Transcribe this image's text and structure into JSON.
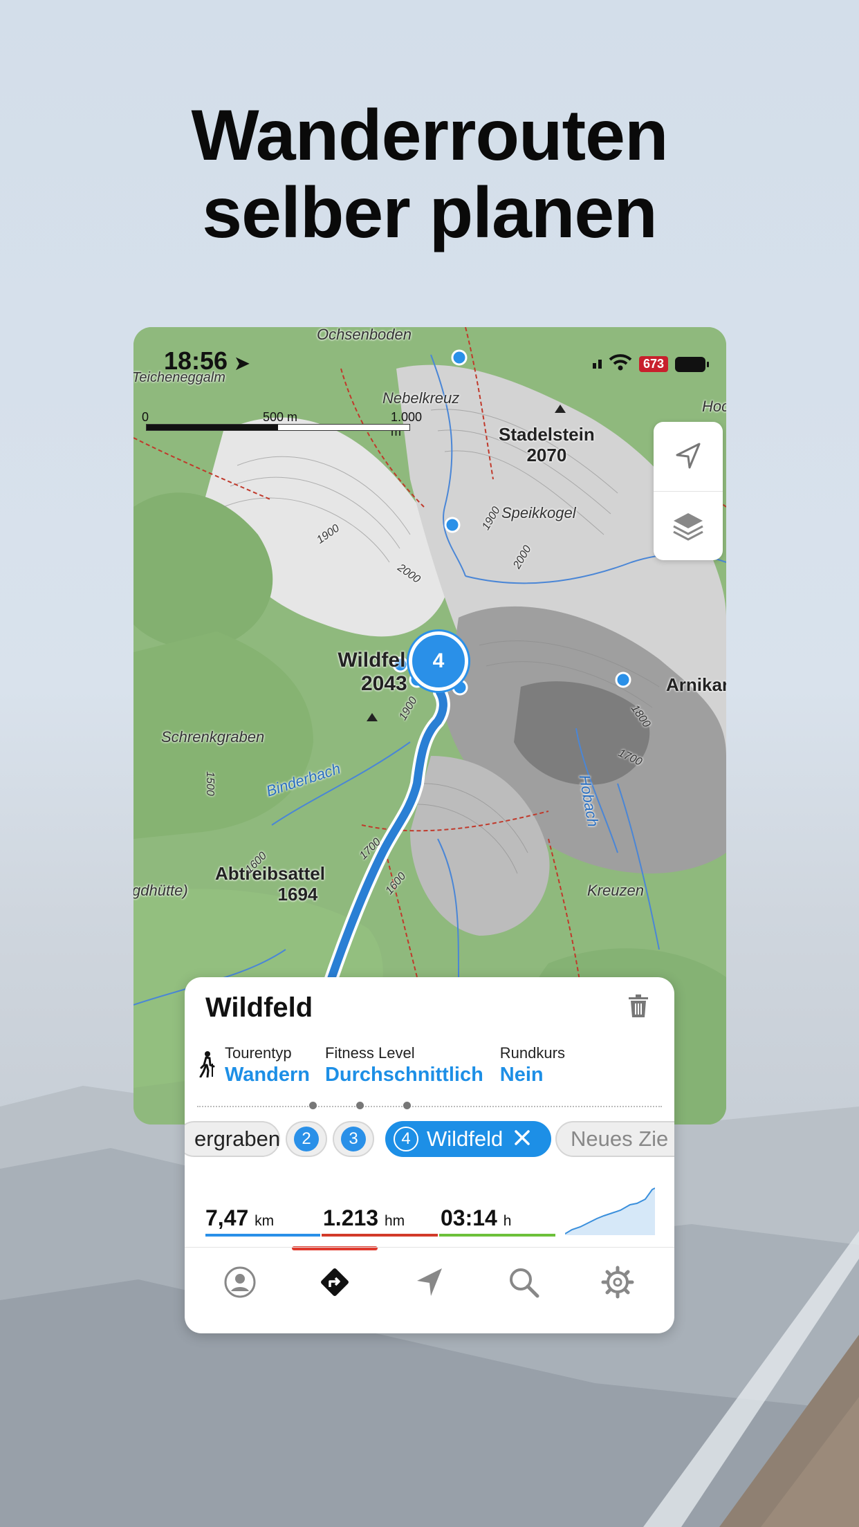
{
  "headline": {
    "line1": "Wanderrouten",
    "line2": "selber planen"
  },
  "status_bar": {
    "time": "18:56",
    "altitude_badge": "673"
  },
  "map": {
    "scale": {
      "tick0": "0",
      "tick1": "500 m",
      "tick2": "1.000 m"
    },
    "labels": {
      "ochsenboden": "Ochsenboden",
      "teicheneggalm": "Teicheneggalm",
      "nebelkreuz": "Nebelkreuz",
      "stadelstein": "Stadelstein",
      "stadelstein_alt": "2070",
      "speikkogel": "Speikkogel",
      "wildfeld": "Wildfel",
      "wildfeld_alt": "2043",
      "arnikar": "Arnikar",
      "schrenkgraben": "Schrenkgraben",
      "bindenbach": "Binderbach",
      "abtreibsattel": "Abtreibsattel",
      "abtreibsattel_alt": "1694",
      "jagdhuette": "gdhütte)",
      "kreuzen": "Kreuzen",
      "hobach": "Hobach",
      "hoc": "Hoc",
      "c1900a": "1900",
      "c2000a": "2000",
      "c1900b": "1900",
      "c2000b": "2000",
      "c1800": "1800",
      "c1700a": "1700",
      "c1500": "1500",
      "c1600a": "1600",
      "c1700b": "1700",
      "c1600b": "1600",
      "c1900c": "1900"
    },
    "active_waypoint": "4"
  },
  "sheet": {
    "title": "Wildfeld",
    "tour_type_label": "Tourentyp",
    "tour_type_value": "Wandern",
    "fitness_label": "Fitness Level",
    "fitness_value": "Durchschnittlich",
    "round_label": "Rundkurs",
    "round_value": "Nein",
    "chips": {
      "c1": "ergraben",
      "c2": "2",
      "c3": "3",
      "c4_num": "4",
      "c4_label": "Wildfeld",
      "c5": "Neues Zie"
    },
    "stats": {
      "distance": "7,47",
      "distance_unit": "km",
      "elevation": "1.213",
      "elevation_unit": "hm",
      "duration": "03:14",
      "duration_unit": "h"
    }
  },
  "colors": {
    "accent": "#1d8fe6",
    "route": "#2a7fd4",
    "tab_active": "#e03a2e",
    "distance_bar": "#2a90e8",
    "elevation_bar": "#d23a2a",
    "duration_bar": "#6cc03a"
  },
  "tabs": [
    "profile-icon",
    "route-planner-icon",
    "navigate-icon",
    "search-icon",
    "settings-icon"
  ]
}
